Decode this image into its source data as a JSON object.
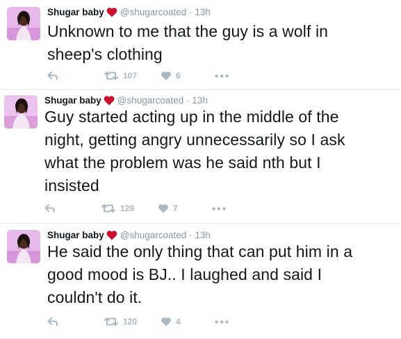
{
  "tweets": [
    {
      "name": "Shugar baby",
      "handle": "@shugarcoated",
      "separator": "·",
      "time": "13h",
      "text_lines": [
        "Unknown to me that the guy is a wolf in",
        "sheep's clothing"
      ],
      "retweets": "107",
      "likes": "6"
    },
    {
      "name": "Shugar baby",
      "handle": "@shugarcoated",
      "separator": "·",
      "time": "13h",
      "text_lines": [
        "Guy started acting up in the middle of the",
        "night, getting angry unnecessarily so I ask",
        "what the problem was he said nth but I",
        "insisted"
      ],
      "retweets": "129",
      "likes": "7"
    },
    {
      "name": "Shugar baby",
      "handle": "@shugarcoated",
      "separator": "·",
      "time": "13h",
      "text_lines": [
        "He said the only thing that can put him in a",
        "good mood is BJ.. I laughed and said I",
        "couldn't do it."
      ],
      "retweets": "120",
      "likes": "4"
    }
  ],
  "icons": {
    "name_badge": "red-heart-icon",
    "reply": "reply-icon",
    "retweet": "retweet-icon",
    "like": "heart-icon",
    "more": "more-icon"
  },
  "colors": {
    "name_heart": "#c8102e",
    "secondary_text": "#8899a6",
    "action_icons": "#aab8c2",
    "divider": "#e1e8ed"
  }
}
